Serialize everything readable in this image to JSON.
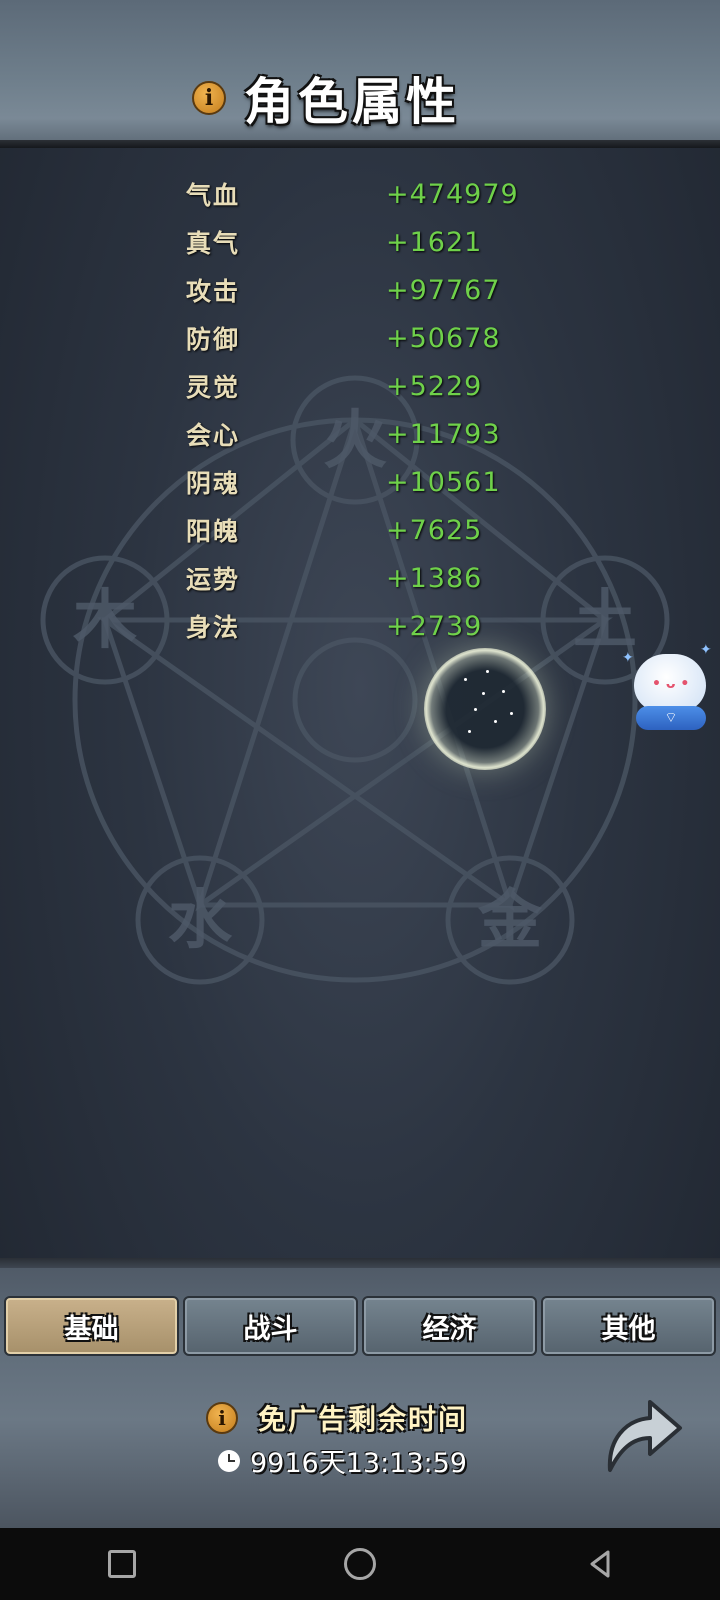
{
  "header": {
    "title": "角色属性",
    "info_icon": "i"
  },
  "stats": [
    {
      "label": "气血",
      "value": "+474979"
    },
    {
      "label": "真气",
      "value": "+1621"
    },
    {
      "label": "攻击",
      "value": "+97767"
    },
    {
      "label": "防御",
      "value": "+50678"
    },
    {
      "label": "灵觉",
      "value": "+5229"
    },
    {
      "label": "会心",
      "value": "+11793"
    },
    {
      "label": "阴魂",
      "value": "+10561"
    },
    {
      "label": "阳魄",
      "value": "+7625"
    },
    {
      "label": "运势",
      "value": "+1386"
    },
    {
      "label": "身法",
      "value": "+2739"
    }
  ],
  "decor": {
    "elements": [
      "火",
      "土",
      "金",
      "水",
      "木"
    ]
  },
  "tabs": [
    {
      "label": "基础",
      "active": true
    },
    {
      "label": "战斗",
      "active": false
    },
    {
      "label": "经济",
      "active": false
    },
    {
      "label": "其他",
      "active": false
    }
  ],
  "ad_free": {
    "label": "免广告剩余时间",
    "info_icon": "i",
    "remaining": "9916天13:13:59"
  },
  "icons": {
    "info": "info-icon",
    "clock": "clock-icon",
    "back": "curved-arrow-icon",
    "assistant": "cloud-assistant-icon"
  },
  "colors": {
    "stat_label": "#e8ddb8",
    "stat_value": "#6fd14a",
    "active_tab": "#c9b18b",
    "info_icon": "#e09a2c"
  }
}
